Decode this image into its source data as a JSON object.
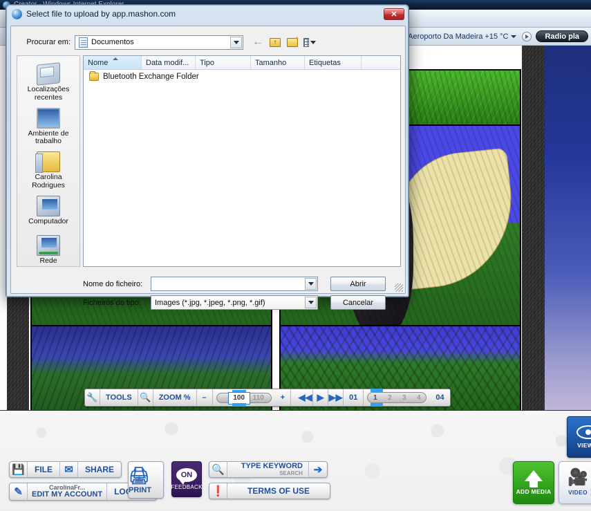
{
  "browser": {
    "window_title": "Creator - Windows Internet Explorer",
    "weather": "Aeroporto Da Madeira +15 °C",
    "radio_label": "Radio pla"
  },
  "dialog": {
    "title": "Select file to upload by app.mashon.com",
    "close_label": "✕",
    "look_in_label": "Procurar em:",
    "look_in_value": "Documentos",
    "nav": {
      "back": "←",
      "up_folder": "up-one-level",
      "new_folder": "create-new-folder",
      "views": "views"
    },
    "places": [
      {
        "label": "Localizações recentes",
        "icon": "recent-places-icon"
      },
      {
        "label": "Ambiente de trabalho",
        "icon": "desktop-icon"
      },
      {
        "label": "Carolina Rodrigues",
        "icon": "user-folder-icon"
      },
      {
        "label": "Computador",
        "icon": "computer-icon"
      },
      {
        "label": "Rede",
        "icon": "network-icon"
      }
    ],
    "columns": [
      {
        "label": "Nome",
        "width": 84,
        "sorted": true
      },
      {
        "label": "Data modif...",
        "width": 78,
        "sorted": false
      },
      {
        "label": "Tipo",
        "width": 80,
        "sorted": false
      },
      {
        "label": "Tamanho",
        "width": 78,
        "sorted": false
      },
      {
        "label": "Etiquetas",
        "width": 82,
        "sorted": false
      },
      {
        "label": "",
        "width": 56,
        "sorted": false
      }
    ],
    "files": [
      {
        "name": "Bluetooth Exchange Folder",
        "icon": "folder-icon"
      }
    ],
    "filename_label": "Nome do ficheiro:",
    "filename_value": "",
    "filetype_label": "Ficheiros do tipo:",
    "filetype_value": "Images (*.jpg, *.jpeg, *.png, *.gif)",
    "open_button": "Abrir",
    "cancel_button": "Cancelar"
  },
  "media_toolbar": {
    "tools_label": "TOOLS",
    "tools_icon": "wrench-icon",
    "zoom_icon": "magnifier-plus-icon",
    "zoom_label": "ZOOM %",
    "zoom_minus": "–",
    "zoom_plus": "+",
    "zoom_value": "100",
    "zoom_ghost": "110",
    "prev_icon": "◀◀",
    "play_icon": "▶",
    "next_icon": "▶▶",
    "page_current": "01",
    "page_total": "04",
    "page_ticks": [
      "1",
      "2",
      "3",
      "4"
    ],
    "page_active_index": 0
  },
  "bottom_bar": {
    "file_label": "FILE",
    "file_icon": "floppy-disk-icon",
    "share_label": "SHARE",
    "share_icon": "envelope-icon",
    "print_label": "PRINT",
    "print_icon": "printer-icon",
    "account_user": "CarolinaFr...",
    "account_label": "EDIT MY ACCOUNT",
    "account_icon": "pencil-icon",
    "logout_label": "LOGOUT",
    "feedback_logo": "ON",
    "feedback_label": "FEEDBACK",
    "search_icon": "magnifier-icon",
    "search_title": "TYPE KEYWORD",
    "search_sub": "SEARCH",
    "search_go_icon": "arrow-right-icon",
    "terms_icon": "exclamation-icon",
    "terms_label": "TERMS OF USE",
    "add_media_label": "ADD MEDIA",
    "add_media_icon": "upload-arrow-icon",
    "video_label": "VIDEO",
    "video_icon": "video-camera-icon",
    "view_all_label": "VIEW A",
    "view_all_icon": "eye-icon"
  },
  "colors": {
    "accent_blue": "#1f4e9c",
    "add_media_green": "#33a51c",
    "feedback_purple": "#3c1f63",
    "close_red": "#bc2f2f"
  }
}
